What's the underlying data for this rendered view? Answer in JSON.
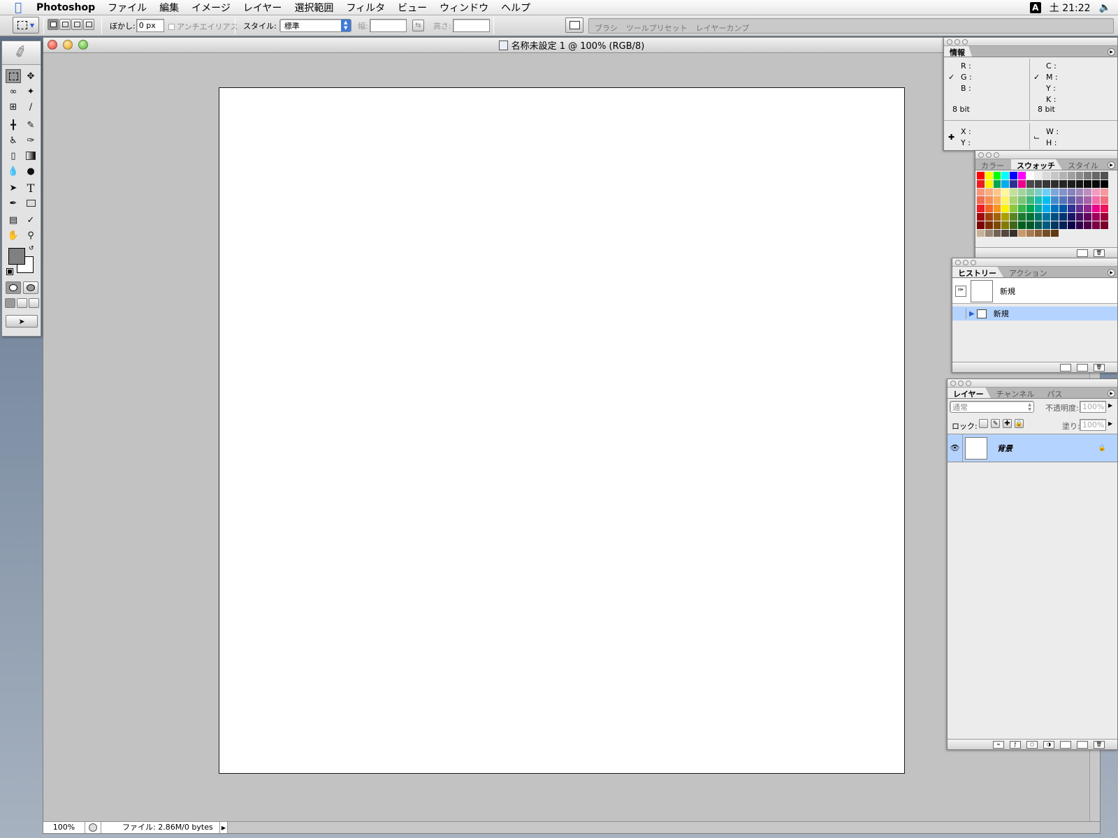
{
  "menubar": {
    "app_name": "Photoshop",
    "menus": [
      "ファイル",
      "編集",
      "イメージ",
      "レイヤー",
      "選択範囲",
      "フィルタ",
      "ビュー",
      "ウィンドウ",
      "ヘルプ"
    ],
    "input_indicator": "A",
    "clock": "土 21:22"
  },
  "options_bar": {
    "feather_label": "ぼかし:",
    "feather_value": "0 px",
    "antialias_label": "アンチエイリアス",
    "style_label": "スタイル:",
    "style_value": "標準",
    "width_label": "幅:",
    "height_label": "高さ:",
    "palette_well_tabs": [
      "ブラシ",
      "ツールプリセット",
      "レイヤーカンプ"
    ]
  },
  "document": {
    "title": "名称未設定 1 @ 100% (RGB/8)",
    "zoom": "100%",
    "file_info": "ファイル: 2.86M/0 bytes"
  },
  "toolbox": {
    "tools": [
      "rectangular-marquee",
      "move",
      "lasso",
      "magic-wand",
      "crop",
      "slice",
      "healing-brush",
      "brush",
      "clone-stamp",
      "history-brush",
      "eraser",
      "gradient",
      "blur",
      "dodge",
      "path-selection",
      "type",
      "pen",
      "rectangle",
      "notes",
      "eyedropper",
      "hand",
      "zoom"
    ],
    "foreground_color": "#808080",
    "background_color": "#ffffff"
  },
  "info_panel": {
    "tab": "情報",
    "rgb_labels": [
      "R :",
      "G :",
      "B :"
    ],
    "cmyk_labels": [
      "C :",
      "M :",
      "Y :",
      "K :"
    ],
    "bit_depth_left": "8 bit",
    "bit_depth_right": "8 bit",
    "xy_labels": [
      "X :",
      "Y :"
    ],
    "wh_labels": [
      "W :",
      "H :"
    ]
  },
  "swatches_panel": {
    "tabs": [
      "カラー",
      "スウォッチ",
      "スタイル"
    ],
    "active_tab": "スウォッチ",
    "rows": [
      [
        "#ff0000",
        "#ffff00",
        "#00ff00",
        "#00ffff",
        "#0000ff",
        "#ff00ff",
        "#ffffff",
        "#ececec",
        "#d9d9d9",
        "#c6c6c6",
        "#b3b3b3",
        "#a0a0a0",
        "#8c8c8c",
        "#797979",
        "#666666",
        "#535353"
      ],
      [
        "#ee1c24",
        "#fff200",
        "#00a651",
        "#00aeef",
        "#2e3192",
        "#ec008c",
        "#4a4a4a",
        "#3f3f3f",
        "#363636",
        "#2d2d2d",
        "#252525",
        "#1d1d1d",
        "#151515",
        "#0e0e0e",
        "#070707",
        "#000000"
      ],
      [
        "#f7977a",
        "#f9ad81",
        "#fdc68a",
        "#fff79a",
        "#c4df9b",
        "#a3d39c",
        "#82ca9d",
        "#7bcdc8",
        "#6ecff6",
        "#7ea7d8",
        "#8493ca",
        "#8882be",
        "#a187be",
        "#bc8dbf",
        "#f49ac2",
        "#f6989d"
      ],
      [
        "#f26c4f",
        "#f68e55",
        "#fbaf5d",
        "#fff467",
        "#acd372",
        "#7cc576",
        "#3bb878",
        "#1abbb4",
        "#00bff3",
        "#438cca",
        "#5574b9",
        "#605ca8",
        "#855fa8",
        "#a763a8",
        "#f06ea9",
        "#f26d7d"
      ],
      [
        "#ed1c24",
        "#f26522",
        "#f7941d",
        "#fff200",
        "#8dc73f",
        "#39b54a",
        "#00a651",
        "#00a99d",
        "#00aeef",
        "#0072bc",
        "#0054a6",
        "#2e3192",
        "#662d91",
        "#92278f",
        "#ec008c",
        "#ed145b"
      ],
      [
        "#9e0b0f",
        "#a0410d",
        "#a36209",
        "#aba000",
        "#598527",
        "#1a7b30",
        "#007236",
        "#00746b",
        "#0076a3",
        "#004b80",
        "#003471",
        "#1b1464",
        "#440e62",
        "#630460",
        "#9e005d",
        "#9e0039"
      ],
      [
        "#790000",
        "#7b2e00",
        "#7d4900",
        "#827b00",
        "#406618",
        "#005e20",
        "#005826",
        "#005952",
        "#005b7f",
        "#003663",
        "#002157",
        "#0d004c",
        "#32004b",
        "#4b0049",
        "#7b0046",
        "#7a0026"
      ],
      [
        "#c7b299",
        "#998675",
        "#736357",
        "#534741",
        "#37302a",
        "#c69c6d",
        "#a67c52",
        "#8c6239",
        "#754c24",
        "#603913"
      ]
    ]
  },
  "history_panel": {
    "tabs": [
      "ヒストリー",
      "アクション"
    ],
    "snapshot_label": "新規",
    "states": [
      "新規"
    ]
  },
  "layers_panel": {
    "tabs": [
      "レイヤー",
      "チャンネル",
      "パス"
    ],
    "blend_mode": "通常",
    "opacity_label": "不透明度:",
    "opacity_value": "100%",
    "lock_label": "ロック:",
    "fill_label": "塗り:",
    "fill_value": "100%",
    "layers": [
      {
        "name": "背景",
        "visible": true,
        "locked": true
      }
    ]
  },
  "colors": {
    "selection_blue": "#b5d3ff",
    "document_bg": "#c2c2c2"
  }
}
